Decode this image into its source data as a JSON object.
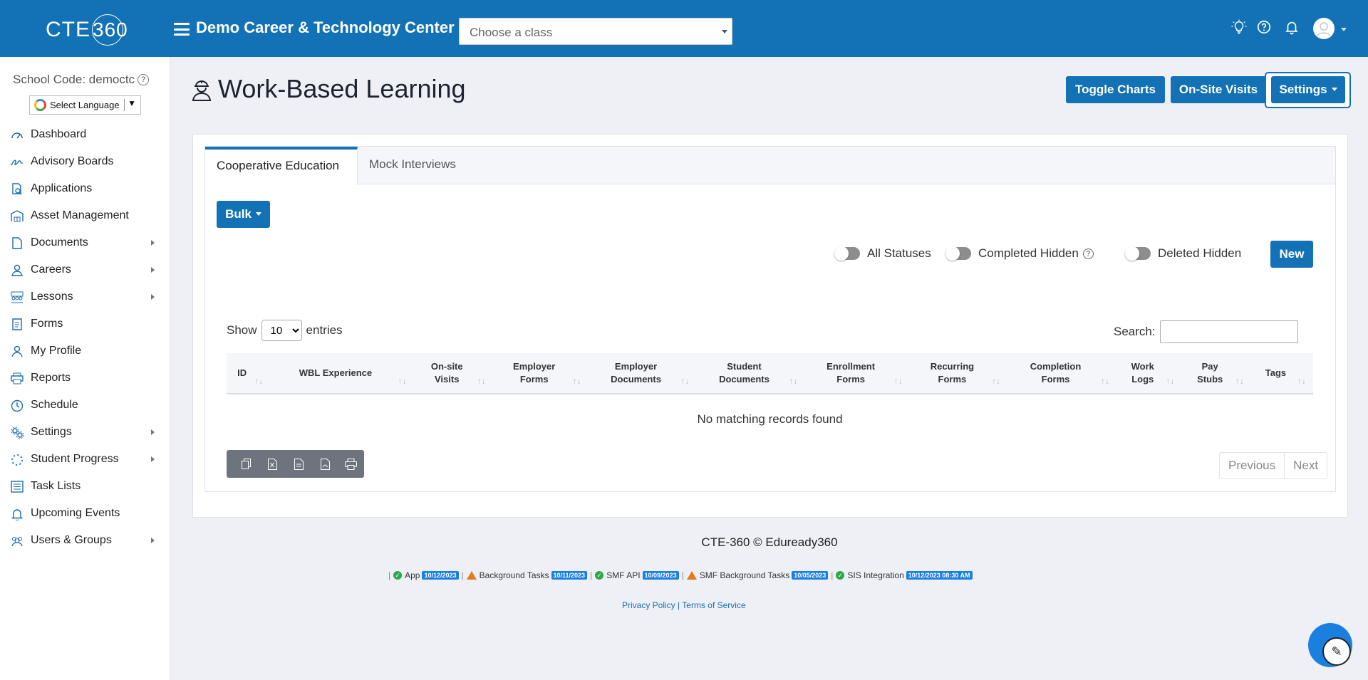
{
  "header": {
    "logo_text": "CTE",
    "logo_circle": "360",
    "org_name": "Demo Career & Technology Center",
    "class_select_placeholder": "Choose a class"
  },
  "sidebar": {
    "school_code": "School Code: democtc",
    "language_label": "Select Language",
    "items": [
      {
        "label": "Dashboard",
        "icon": "dashboard-icon",
        "submenu": false
      },
      {
        "label": "Advisory Boards",
        "icon": "signature-icon",
        "submenu": false
      },
      {
        "label": "Applications",
        "icon": "document-search-icon",
        "submenu": false
      },
      {
        "label": "Asset Management",
        "icon": "warehouse-icon",
        "submenu": false
      },
      {
        "label": "Documents",
        "icon": "document-icon",
        "submenu": true
      },
      {
        "label": "Careers",
        "icon": "person-tie-icon",
        "submenu": true
      },
      {
        "label": "Lessons",
        "icon": "classroom-icon",
        "submenu": true
      },
      {
        "label": "Forms",
        "icon": "form-icon",
        "submenu": false
      },
      {
        "label": "My Profile",
        "icon": "user-icon",
        "submenu": false
      },
      {
        "label": "Reports",
        "icon": "printer-icon",
        "submenu": false
      },
      {
        "label": "Schedule",
        "icon": "clock-icon",
        "submenu": false
      },
      {
        "label": "Settings",
        "icon": "gears-icon",
        "submenu": true
      },
      {
        "label": "Student Progress",
        "icon": "spinner-icon",
        "submenu": true
      },
      {
        "label": "Task Lists",
        "icon": "list-icon",
        "submenu": false
      },
      {
        "label": "Upcoming Events",
        "icon": "bell-icon",
        "submenu": false
      },
      {
        "label": "Users & Groups",
        "icon": "users-icon",
        "submenu": true
      }
    ]
  },
  "page": {
    "title": "Work-Based Learning",
    "buttons": {
      "toggle_charts": "Toggle Charts",
      "onsite_visits": "On-Site Visits",
      "settings": "Settings"
    }
  },
  "tabs": [
    "Cooperative Education",
    "Mock Interviews"
  ],
  "toolbar": {
    "bulk": "Bulk",
    "toggles": [
      "All Statuses",
      "Completed Hidden",
      "Deleted Hidden"
    ],
    "new": "New"
  },
  "table": {
    "show_label": "Show",
    "entries_value": "10",
    "entries_label": "entries",
    "search_label": "Search:",
    "columns": [
      [
        "ID"
      ],
      [
        "WBL Experience"
      ],
      [
        "On-site",
        "Visits"
      ],
      [
        "Employer",
        "Forms"
      ],
      [
        "Employer",
        "Documents"
      ],
      [
        "Student",
        "Documents"
      ],
      [
        "Enrollment",
        "Forms"
      ],
      [
        "Recurring",
        "Forms"
      ],
      [
        "Completion",
        "Forms"
      ],
      [
        "Work",
        "Logs"
      ],
      [
        "Pay",
        "Stubs"
      ],
      [
        "Tags"
      ]
    ],
    "empty_message": "No matching records found",
    "pager": {
      "previous": "Previous",
      "next": "Next"
    }
  },
  "footer": {
    "copyright": "CTE-360 © Eduready360",
    "statuses": [
      {
        "label": "App",
        "date": "10/12/2023",
        "state": "ok"
      },
      {
        "label": "Background Tasks",
        "date": "10/11/2023",
        "state": "warn"
      },
      {
        "label": "SMF API",
        "date": "10/09/2023",
        "state": "ok"
      },
      {
        "label": "SMF Background Tasks",
        "date": "10/05/2023",
        "state": "warn"
      },
      {
        "label": "SIS Integration",
        "date": "10/12/2023 08:30 AM",
        "state": "ok"
      }
    ],
    "privacy": "Privacy Policy",
    "sep": "|",
    "terms": "Terms of Service"
  },
  "colors": {
    "brand": "#1272b5",
    "ok": "#2aa84a",
    "warn": "#e07b22",
    "badge": "#1a80e0"
  }
}
